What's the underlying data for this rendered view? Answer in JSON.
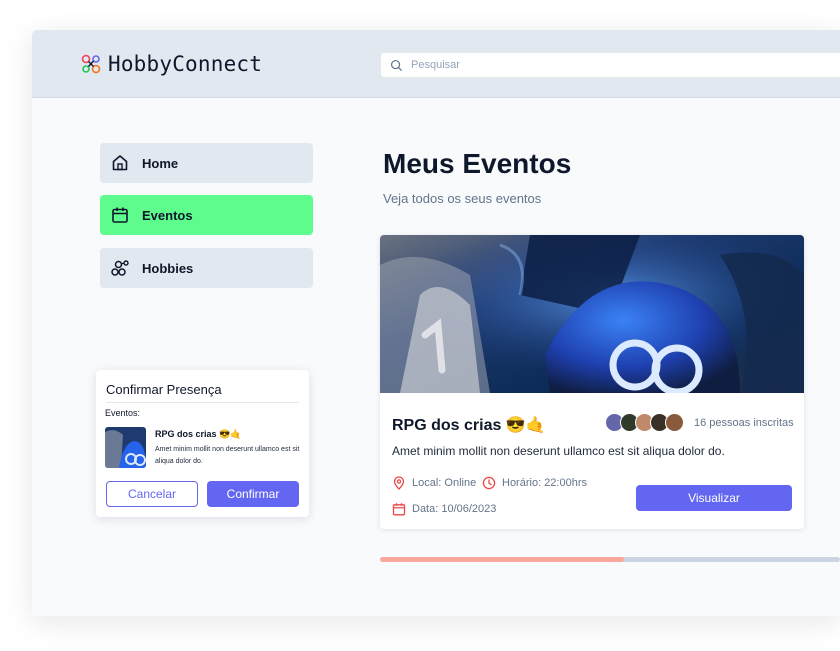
{
  "header": {
    "app_name": "HobbyConnect",
    "search_placeholder": "Pesquisar"
  },
  "sidebar": {
    "items": [
      {
        "label": "Home",
        "icon": "home-icon",
        "active": false
      },
      {
        "label": "Eventos",
        "icon": "calendar-icon",
        "active": true
      },
      {
        "label": "Hobbies",
        "icon": "hobbies-icon",
        "active": false
      }
    ]
  },
  "page": {
    "title": "Meus Eventos",
    "subtitle": "Veja todos os seus eventos"
  },
  "event_card": {
    "title": "RPG dos crias 😎🤙",
    "description": "Amet minim mollit non deserunt ullamco est sit aliqua dolor do.",
    "enrolled": "16 pessoas inscritas",
    "location": "Local: Online",
    "time": "Horário: 22:00hrs",
    "date": "Data: 10/06/2023",
    "button_label": "Visualizar"
  },
  "carousel": {
    "progress_fraction": 0.53
  },
  "confirm_popup": {
    "title": "Confirmar Presença",
    "subtitle": "Eventos:",
    "event_title": "RPG dos crias 😎🤙",
    "event_description": "Amet minim mollit non deserunt ullamco est sit aliqua dolor do.",
    "cancel_label": "Cancelar",
    "confirm_label": "Confirmar"
  },
  "colors": {
    "accent": "#6366f1",
    "active_nav": "#5efc8d",
    "header_bg": "#e2e8f0",
    "progress_fill": "#f9a89b",
    "icon_red": "#ef4444"
  }
}
